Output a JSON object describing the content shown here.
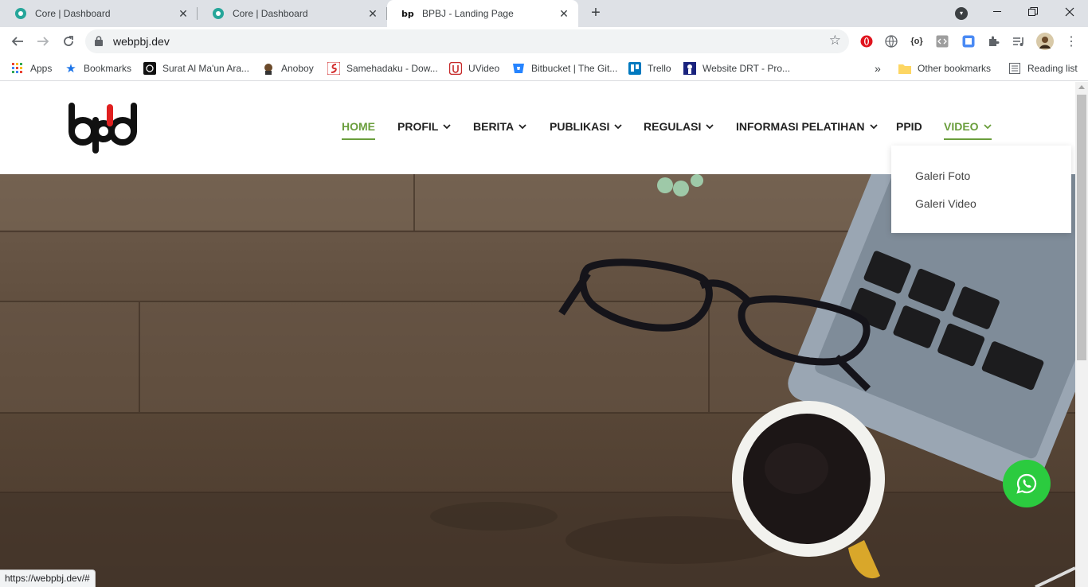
{
  "browser": {
    "tabs": [
      {
        "title": "Core | Dashboard",
        "favicon": "core-favicon",
        "active": false
      },
      {
        "title": "Core | Dashboard",
        "favicon": "core-favicon",
        "active": false
      },
      {
        "title": "BPBJ - Landing Page",
        "favicon": "bpbj-favicon",
        "active": true
      }
    ],
    "new_tab_label": "+",
    "url": "webpbj.dev",
    "bookmarks": [
      {
        "label": "Apps",
        "icon": "apps-grid-icon"
      },
      {
        "label": "Bookmarks",
        "icon": "star-icon"
      },
      {
        "label": "Surat Al Ma'un Ara...",
        "icon": "quran-icon"
      },
      {
        "label": "Anoboy",
        "icon": "anoboy-icon"
      },
      {
        "label": "Samehadaku - Dow...",
        "icon": "samehadaku-icon"
      },
      {
        "label": "UVideo",
        "icon": "uvideo-icon"
      },
      {
        "label": "Bitbucket | The Git...",
        "icon": "bitbucket-icon"
      },
      {
        "label": "Trello",
        "icon": "trello-icon"
      },
      {
        "label": "Website DRT - Pro...",
        "icon": "drt-icon"
      }
    ],
    "overflow_label": "»",
    "other_bookmarks": "Other bookmarks",
    "reading_list": "Reading list",
    "status_url": "https://webpbj.dev/#"
  },
  "site": {
    "nav": [
      {
        "label": "HOME",
        "dropdown": false,
        "active": true
      },
      {
        "label": "PROFIL",
        "dropdown": true,
        "active": false
      },
      {
        "label": "BERITA",
        "dropdown": true,
        "active": false
      },
      {
        "label": "PUBLIKASI",
        "dropdown": true,
        "active": false
      },
      {
        "label": "REGULASI",
        "dropdown": true,
        "active": false
      },
      {
        "label": "INFORMASI PELATIHAN",
        "dropdown": true,
        "active": false
      },
      {
        "label": "PPID",
        "dropdown": false,
        "active": false
      },
      {
        "label": "VIDEO",
        "dropdown": true,
        "active": true
      }
    ],
    "video_dropdown": [
      "Galeri Foto",
      "Galeri Video"
    ]
  },
  "colors": {
    "accent_green": "#6a9e3c",
    "whatsapp_green": "#2bcb3f",
    "logo_red": "#e02020"
  }
}
